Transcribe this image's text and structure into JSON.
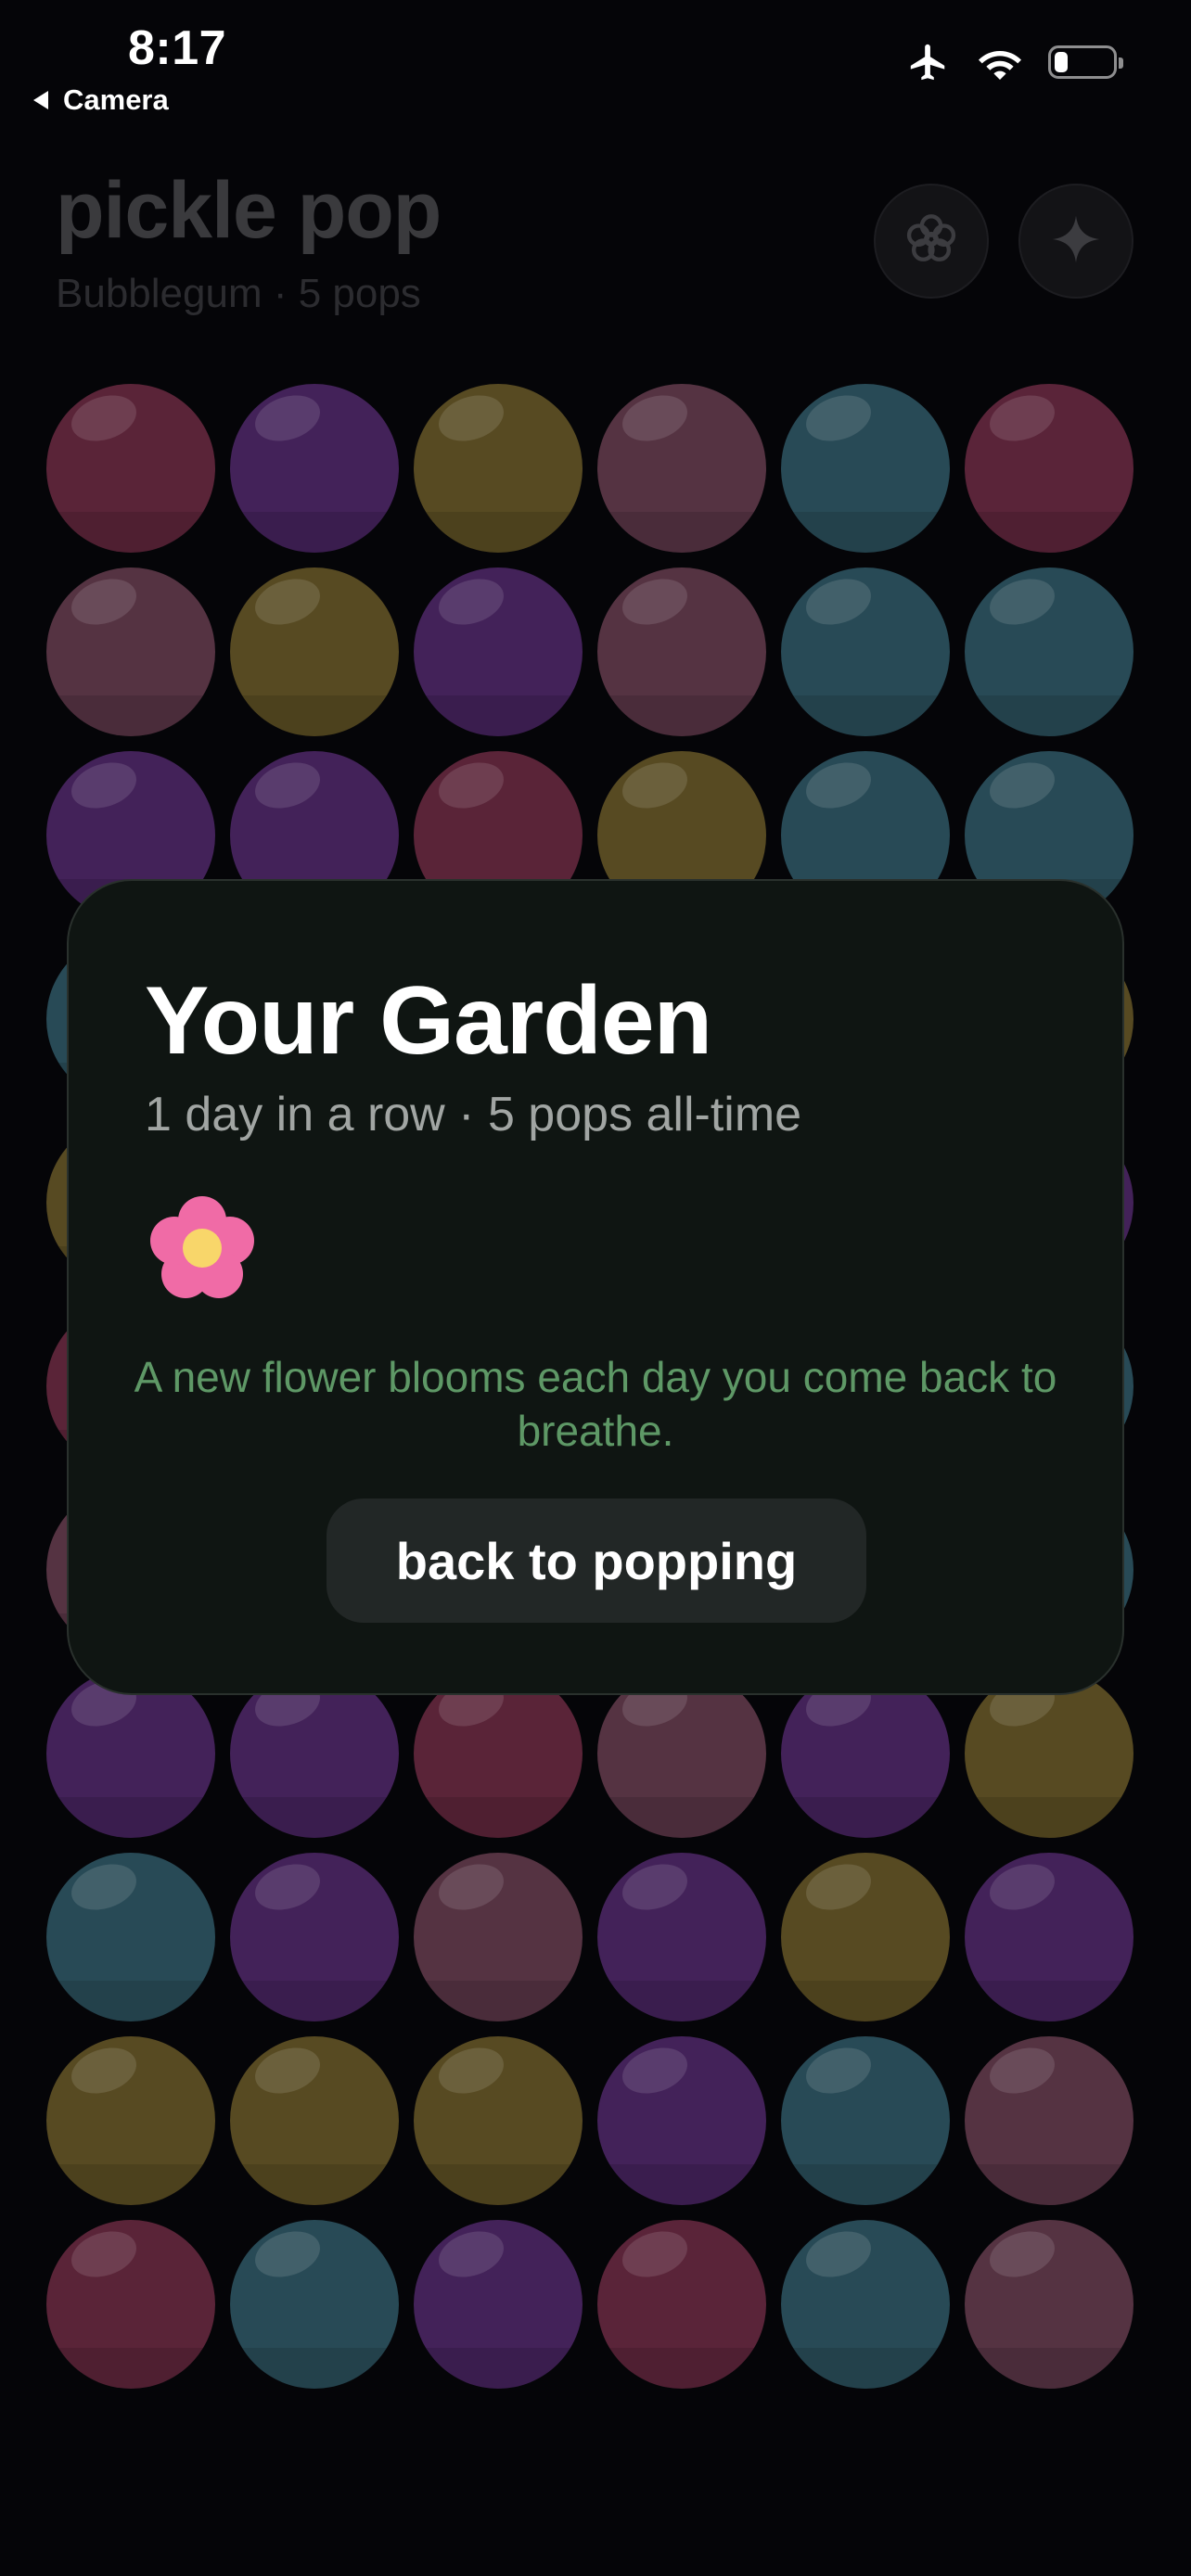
{
  "status_bar": {
    "time": "8:17",
    "back_label": "Camera",
    "icons": [
      "airplane-icon",
      "wifi-icon",
      "battery-icon"
    ]
  },
  "header": {
    "title": "pickle pop",
    "subtitle": "Bubblegum · 5 pops",
    "buttons": [
      "flower-icon",
      "sparkle-icon"
    ]
  },
  "grid": {
    "columns": 6,
    "rows": [
      [
        "crimson",
        "purple",
        "olive",
        "rose",
        "teal",
        "pinkred"
      ],
      [
        "rose",
        "olive",
        "purple",
        "rose",
        "teal",
        "teal"
      ],
      [
        "purple",
        "purple",
        "crimson",
        "olive",
        "teal",
        "teal"
      ],
      [
        "teal",
        "purple",
        "purple",
        "crimson",
        "olive",
        "olive"
      ],
      [
        "olive",
        "rose",
        "teal",
        "purple",
        "crimson",
        "purple"
      ],
      [
        "crimson",
        "teal",
        "olive",
        "purple",
        "rose",
        "teal"
      ],
      [
        "rose",
        "crimson",
        "purple",
        "teal",
        "olive",
        "teal"
      ],
      [
        "purple",
        "purple",
        "crimson",
        "rose",
        "purple",
        "olive"
      ],
      [
        "teal",
        "purple",
        "rose",
        "purple",
        "olive",
        "purple"
      ],
      [
        "olive",
        "olive",
        "olive",
        "purple",
        "teal",
        "rose"
      ],
      [
        "crimson",
        "teal",
        "purple",
        "pinkred",
        "teal",
        "rose"
      ]
    ]
  },
  "colors": {
    "crimson": "#5a2438",
    "purple": "#432259",
    "olive": "#574a22",
    "rose": "#553342",
    "teal": "#284a56",
    "pinkred": "#5a2439",
    "modal_bg": "#0f1512",
    "message_green": "#5e9866",
    "flower_pink": "#f06ba6",
    "flower_center": "#f8d66a"
  },
  "garden_modal": {
    "title": "Your Garden",
    "subtitle": "1 day in a row · 5 pops all-time",
    "flowers": [
      "flower-icon"
    ],
    "message": "A new flower blooms each day you come back to breathe.",
    "button_label": "back to popping"
  }
}
